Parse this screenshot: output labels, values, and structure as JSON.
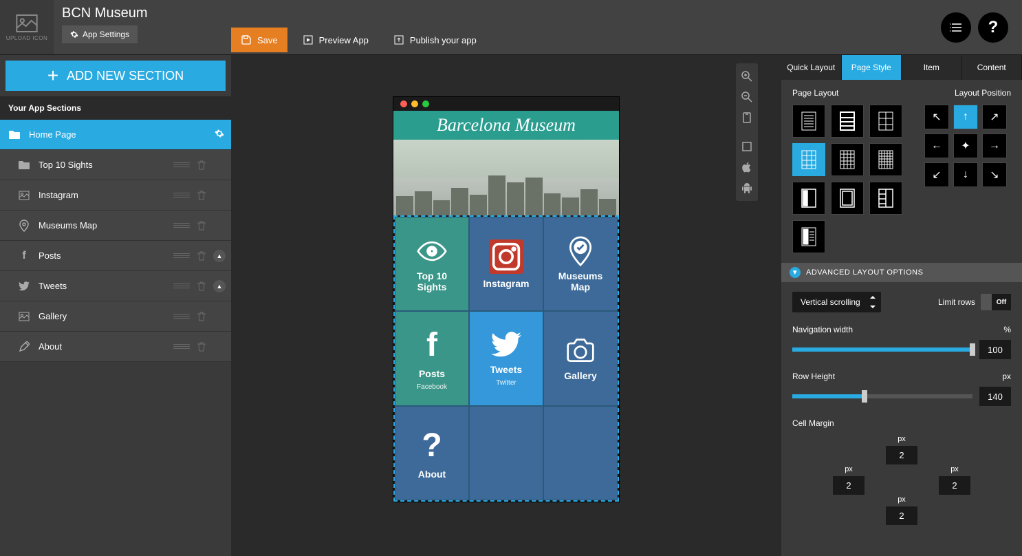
{
  "header": {
    "app_title": "BCN Museum",
    "upload_icon_label": "UPLOAD ICON",
    "settings_btn": "App Settings"
  },
  "toolbar": {
    "save": "Save",
    "preview": "Preview App",
    "publish": "Publish your app"
  },
  "sidebar": {
    "add_section": "ADD NEW SECTION",
    "header": "Your App Sections",
    "items": [
      {
        "label": "Home Page",
        "active": true
      },
      {
        "label": "Top 10 Sights"
      },
      {
        "label": "Instagram"
      },
      {
        "label": "Museums Map"
      },
      {
        "label": "Posts",
        "collapsible": true
      },
      {
        "label": "Tweets",
        "collapsible": true
      },
      {
        "label": "Gallery"
      },
      {
        "label": "About"
      }
    ]
  },
  "preview": {
    "title": "Barcelona Museum",
    "tiles": [
      {
        "label": "Top 10 Sights"
      },
      {
        "label": "Instagram"
      },
      {
        "label": "Museums Map"
      },
      {
        "label": "Posts",
        "sub": "Facebook"
      },
      {
        "label": "Tweets",
        "sub": "Twitter"
      },
      {
        "label": "Gallery"
      },
      {
        "label": "About"
      }
    ]
  },
  "right": {
    "tabs": [
      "Quick Layout",
      "Page Style",
      "Item",
      "Content"
    ],
    "active_tab": 1,
    "page_layout_label": "Page Layout",
    "layout_position_label": "Layout Position",
    "advanced_label": "ADVANCED LAYOUT OPTIONS",
    "scroll_select": "Vertical scrolling",
    "limit_rows_label": "Limit rows",
    "limit_rows_value": "Off",
    "nav_width": {
      "label": "Navigation width",
      "unit": "%",
      "value": "100",
      "pct": 100
    },
    "row_height": {
      "label": "Row Height",
      "unit": "px",
      "value": "140",
      "pct": 40
    },
    "cell_margin": {
      "label": "Cell Margin",
      "unit": "px",
      "top": "2",
      "right": "2",
      "bottom": "2",
      "left": "2"
    }
  }
}
